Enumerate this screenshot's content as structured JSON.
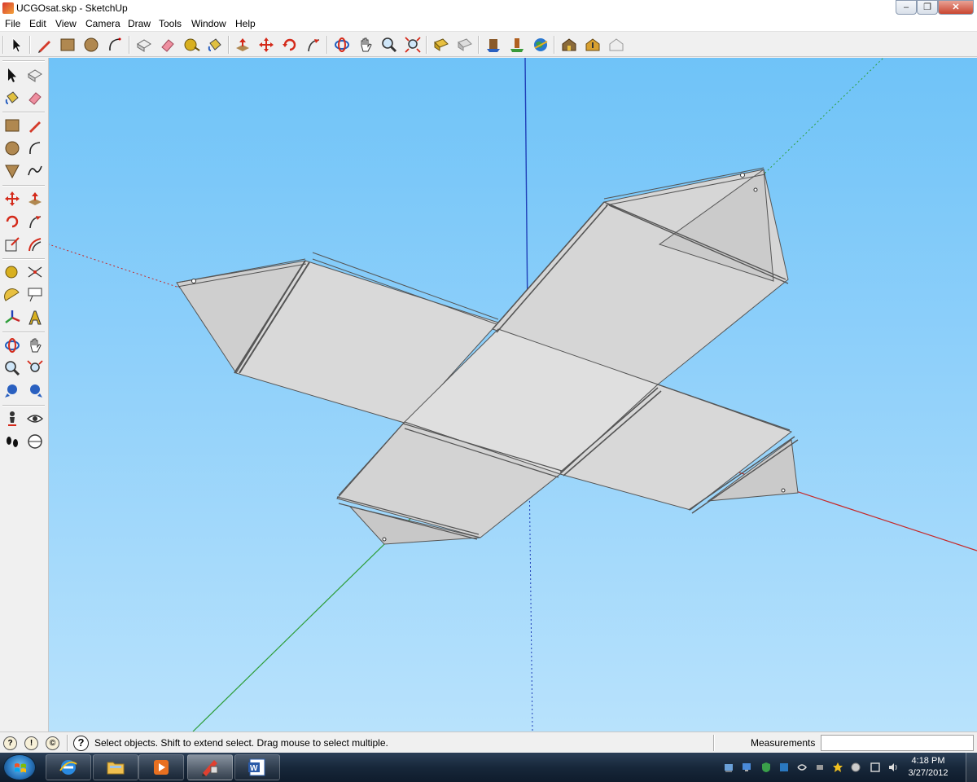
{
  "window": {
    "title": "UCGOsat.skp - SketchUp",
    "minimize": "–",
    "maximize": "❐",
    "close": "✕"
  },
  "menu": [
    "File",
    "Edit",
    "View",
    "Camera",
    "Draw",
    "Tools",
    "Window",
    "Help"
  ],
  "toolbar_top": [
    "select-icon",
    "pencil-icon",
    "rectangle-icon",
    "circle-icon",
    "arc-icon",
    "make-component-icon",
    "eraser-icon",
    "tape-measure-icon",
    "paint-bucket-icon",
    "push-pull-icon",
    "move-icon",
    "rotate-icon",
    "follow-me-icon",
    "orbit-icon",
    "pan-icon",
    "zoom-icon",
    "zoom-extents-icon",
    "get-models-icon",
    "share-model-icon",
    "component-icon",
    "place-model-icon",
    "google-earth-icon",
    "warehouse-icon",
    "extension-icon",
    "export-icon"
  ],
  "toolbar_left": [
    "select-icon",
    "make-component-icon",
    "paint-bucket-icon",
    "eraser-icon",
    "rectangle-icon",
    "line-icon",
    "circle-icon",
    "arc-icon",
    "polygon-icon",
    "freehand-icon",
    "move-icon",
    "push-pull-icon",
    "rotate-icon",
    "follow-me-icon",
    "scale-icon",
    "offset-icon",
    "tape-measure-icon",
    "dimension-icon",
    "protractor-icon",
    "text-icon",
    "axes-icon",
    "3d-text-icon",
    "orbit-icon",
    "pan-icon",
    "zoom-icon",
    "zoom-window-icon",
    "previous-view-icon",
    "zoom-extents-icon",
    "position-camera-icon",
    "look-around-icon",
    "walk-icon",
    "section-plane-icon"
  ],
  "status": {
    "message": "Select objects. Shift to extend select. Drag mouse to select multiple.",
    "measurements_label": "Measurements",
    "measurements_value": ""
  },
  "taskbar": {
    "apps": [
      "internet-explorer-icon",
      "explorer-folder-icon",
      "media-player-icon",
      "sketchup-icon",
      "word-icon"
    ],
    "active_app": "sketchup-icon",
    "time": "4:18 PM",
    "date": "3/27/2012"
  },
  "colors": {
    "sky_top": "#6fc3f8",
    "sky_bottom": "#b8e2fc",
    "axis_red": "#c62828",
    "axis_green": "#2e9e3a",
    "axis_blue": "#1f3fb8",
    "face": "#dedede"
  }
}
